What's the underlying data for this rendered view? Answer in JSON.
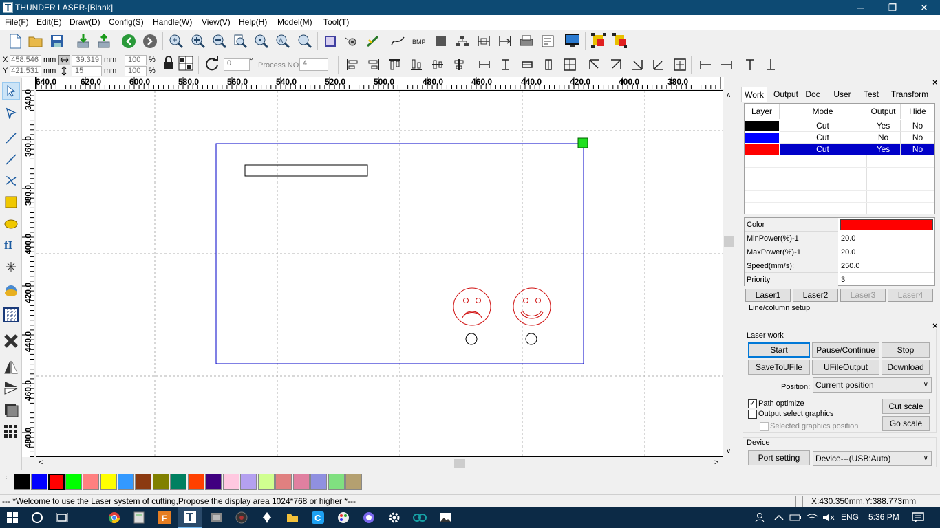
{
  "window": {
    "title": "THUNDER LASER-[Blank]",
    "minimize": "─",
    "maximize": "❐",
    "close": "✕"
  },
  "menu": [
    "File(F)",
    "Edit(E)",
    "Draw(D)",
    "Config(S)",
    "Handle(W)",
    "View(V)",
    "Help(H)",
    "Model(M)",
    "Tool(T)"
  ],
  "toolbar2": {
    "x_label": "X",
    "x_value": "458.546",
    "x_unit": "mm",
    "y_label": "Y",
    "y_value": "421.531",
    "y_unit": "mm",
    "w_value": "39.319",
    "w_unit": "mm",
    "h_value": "15",
    "h_unit": "mm",
    "sx_value": "100",
    "sx_unit": "%",
    "sy_value": "100",
    "sy_unit": "%",
    "angle_value": "0",
    "angle_unit": "°",
    "process_no_label": "Process NO:",
    "process_no_value": "4"
  },
  "ruler": {
    "h_labels": [
      "640.0",
      "620.0",
      "600.0",
      "580.0",
      "560.0",
      "540.0",
      "520.0",
      "500.0",
      "480.0",
      "460.0",
      "440.0",
      "420.0",
      "400.0",
      "380.0"
    ],
    "v_labels": [
      "340.0",
      "360.0",
      "380.0",
      "400.0",
      "420.0",
      "440.0",
      "460.0",
      "480.0"
    ]
  },
  "palette": [
    "#000000",
    "#0000ff",
    "#ff0000",
    "#00ff00",
    "#ff8080",
    "#ffff00",
    "#3399ff",
    "#8b3a10",
    "#808000",
    "#008060",
    "#ff4000",
    "#400080",
    "#ffc8e0",
    "#b4a0f0",
    "#d0ff90",
    "#e08080",
    "#e080a0",
    "#9090e0",
    "#80e080",
    "#b4a070"
  ],
  "status": {
    "message": "--- *Welcome to use the Laser system of cutting,Propose the display area 1024*768 or higher *---",
    "coords": "X:430.350mm,Y:388.773mm"
  },
  "panel": {
    "tabs": [
      "Work",
      "Output",
      "Doc",
      "User",
      "Test",
      "Transform"
    ],
    "layer_headers": [
      "Layer",
      "Mode",
      "Output",
      "Hide"
    ],
    "layers": [
      {
        "color": "#000000",
        "mode": "Cut",
        "output": "Yes",
        "hide": "No",
        "selected": false
      },
      {
        "color": "#0000ff",
        "mode": "Cut",
        "output": "No",
        "hide": "No",
        "selected": false
      },
      {
        "color": "#ff0000",
        "mode": "Cut",
        "output": "Yes",
        "hide": "No",
        "selected": true
      }
    ],
    "props": [
      {
        "label": "Color",
        "value": ""
      },
      {
        "label": "MinPower(%)-1",
        "value": "20.0"
      },
      {
        "label": "MaxPower(%)-1",
        "value": "20.0"
      },
      {
        "label": "Speed(mm/s):",
        "value": "250.0"
      },
      {
        "label": "Priority",
        "value": "3"
      }
    ],
    "prop_color": "#ff0000",
    "laser_tabs": [
      "Laser1",
      "Laser2",
      "Laser3",
      "Laser4"
    ],
    "line_column": "Line/column setup"
  },
  "laserwork": {
    "title": "Laser work",
    "start": "Start",
    "pause": "Pause/Continue",
    "stop": "Stop",
    "save_file": "SaveToUFile",
    "ufile_output": "UFileOutput",
    "download": "Download",
    "position_label": "Position:",
    "position_value": "Current position",
    "path_optimize": "Path optimize",
    "output_select": "Output select graphics",
    "selected_pos": "Selected graphics position",
    "cut_scale": "Cut scale",
    "go_scale": "Go scale",
    "device_title": "Device",
    "port_setting": "Port setting",
    "device_value": "Device---(USB:Auto)"
  },
  "taskbar": {
    "lang": "ENG",
    "time": "5:36 PM"
  },
  "colors": {
    "titlebar": "#0d4a73",
    "selection": "#0000c8",
    "taskbar": "#0c2a46"
  }
}
